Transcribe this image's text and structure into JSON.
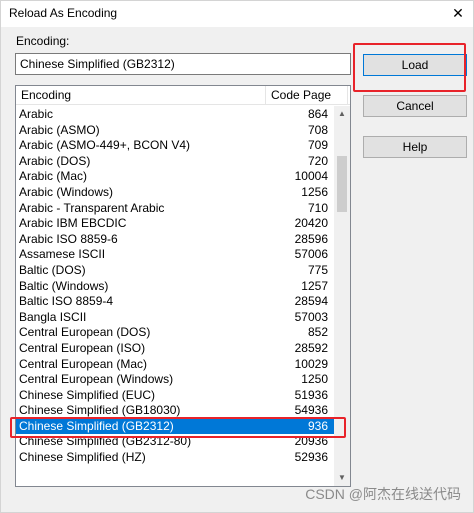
{
  "window": {
    "title": "Reload As Encoding",
    "close_glyph": "✕"
  },
  "encoding": {
    "label": "Encoding:",
    "value": "Chinese Simplified (GB2312)"
  },
  "list": {
    "headers": {
      "encoding": "Encoding",
      "code_page": "Code Page"
    },
    "rows": [
      {
        "encoding": "Arabic",
        "code_page": "864"
      },
      {
        "encoding": "Arabic (ASMO)",
        "code_page": "708"
      },
      {
        "encoding": "Arabic (ASMO-449+, BCON V4)",
        "code_page": "709"
      },
      {
        "encoding": "Arabic (DOS)",
        "code_page": "720"
      },
      {
        "encoding": "Arabic (Mac)",
        "code_page": "10004"
      },
      {
        "encoding": "Arabic (Windows)",
        "code_page": "1256"
      },
      {
        "encoding": "Arabic - Transparent Arabic",
        "code_page": "710"
      },
      {
        "encoding": "Arabic IBM EBCDIC",
        "code_page": "20420"
      },
      {
        "encoding": "Arabic ISO 8859-6",
        "code_page": "28596"
      },
      {
        "encoding": "Assamese ISCII",
        "code_page": "57006"
      },
      {
        "encoding": "Baltic (DOS)",
        "code_page": "775"
      },
      {
        "encoding": "Baltic (Windows)",
        "code_page": "1257"
      },
      {
        "encoding": "Baltic ISO 8859-4",
        "code_page": "28594"
      },
      {
        "encoding": "Bangla ISCII",
        "code_page": "57003"
      },
      {
        "encoding": "Central European (DOS)",
        "code_page": "852"
      },
      {
        "encoding": "Central European (ISO)",
        "code_page": "28592"
      },
      {
        "encoding": "Central European (Mac)",
        "code_page": "10029"
      },
      {
        "encoding": "Central European (Windows)",
        "code_page": "1250"
      },
      {
        "encoding": "Chinese Simplified (EUC)",
        "code_page": "51936"
      },
      {
        "encoding": "Chinese Simplified (GB18030)",
        "code_page": "54936"
      },
      {
        "encoding": "Chinese Simplified (GB2312)",
        "code_page": "936"
      },
      {
        "encoding": "Chinese Simplified (GB2312-80)",
        "code_page": "20936"
      },
      {
        "encoding": "Chinese Simplified (HZ)",
        "code_page": "52936"
      }
    ],
    "selected_index": 20
  },
  "buttons": {
    "load": "Load",
    "cancel": "Cancel",
    "help": "Help"
  },
  "scrollbar": {
    "up_glyph": "▲",
    "down_glyph": "▼"
  },
  "watermark": "CSDN @阿杰在线送代码",
  "colors": {
    "selection": "#0078d7",
    "highlight_border": "#e8232a"
  }
}
